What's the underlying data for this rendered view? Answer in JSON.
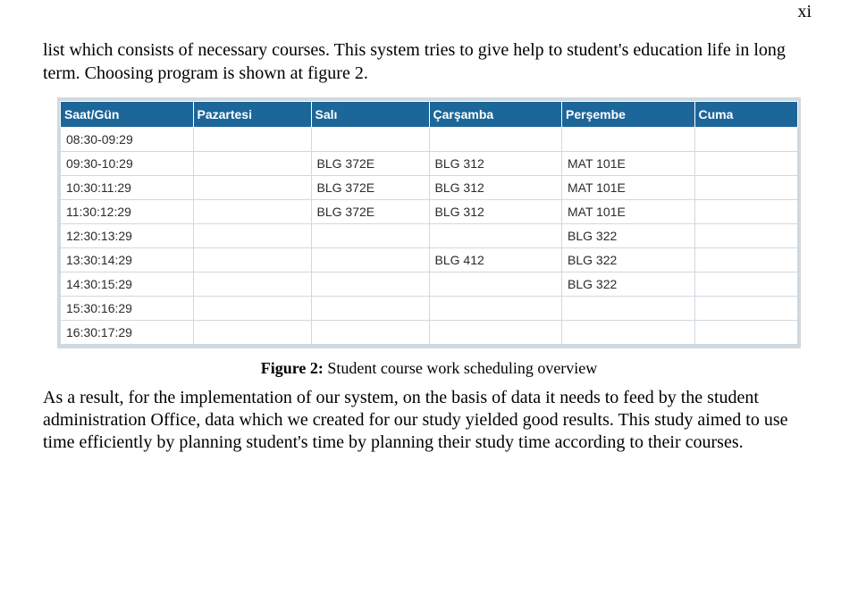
{
  "page_number_roman": "xi",
  "intro_text": "list which consists of necessary courses. This system tries to give help to student's education life in long term. Choosing program is shown at figure 2.",
  "table": {
    "headers": [
      "Saat/Gün",
      "Pazartesi",
      "Salı",
      "Çarşamba",
      "Perşembe",
      "Cuma"
    ],
    "rows": [
      {
        "time": "08:30-09:29",
        "pazartesi": "",
        "sali": "",
        "carsamba": "",
        "persembe": "",
        "cuma": ""
      },
      {
        "time": "09:30-10:29",
        "pazartesi": "",
        "sali": "BLG 372E",
        "carsamba": "BLG 312",
        "persembe": "MAT 101E",
        "cuma": ""
      },
      {
        "time": "10:30:11:29",
        "pazartesi": "",
        "sali": "BLG 372E",
        "carsamba": "BLG 312",
        "persembe": "MAT 101E",
        "cuma": ""
      },
      {
        "time": "11:30:12:29",
        "pazartesi": "",
        "sali": "BLG 372E",
        "carsamba": "BLG 312",
        "persembe": "MAT 101E",
        "cuma": ""
      },
      {
        "time": "12:30:13:29",
        "pazartesi": "",
        "sali": "",
        "carsamba": "",
        "persembe": "BLG 322",
        "cuma": ""
      },
      {
        "time": "13:30:14:29",
        "pazartesi": "",
        "sali": "",
        "carsamba": "BLG 412",
        "persembe": "BLG 322",
        "cuma": ""
      },
      {
        "time": "14:30:15:29",
        "pazartesi": "",
        "sali": "",
        "carsamba": "",
        "persembe": "BLG 322",
        "cuma": ""
      },
      {
        "time": "15:30:16:29",
        "pazartesi": "",
        "sali": "",
        "carsamba": "",
        "persembe": "",
        "cuma": ""
      },
      {
        "time": "16:30:17:29",
        "pazartesi": "",
        "sali": "",
        "carsamba": "",
        "persembe": "",
        "cuma": ""
      }
    ]
  },
  "caption": {
    "label": "Figure 2:",
    "text": "Student course work scheduling overview"
  },
  "body_text": "As a result, for the implementation of our system, on the basis of data it needs to feed by the student administration Office, data which we created for our study yielded good results. This study aimed to use time efficiently by planning student's time by planning their study time according to their courses."
}
